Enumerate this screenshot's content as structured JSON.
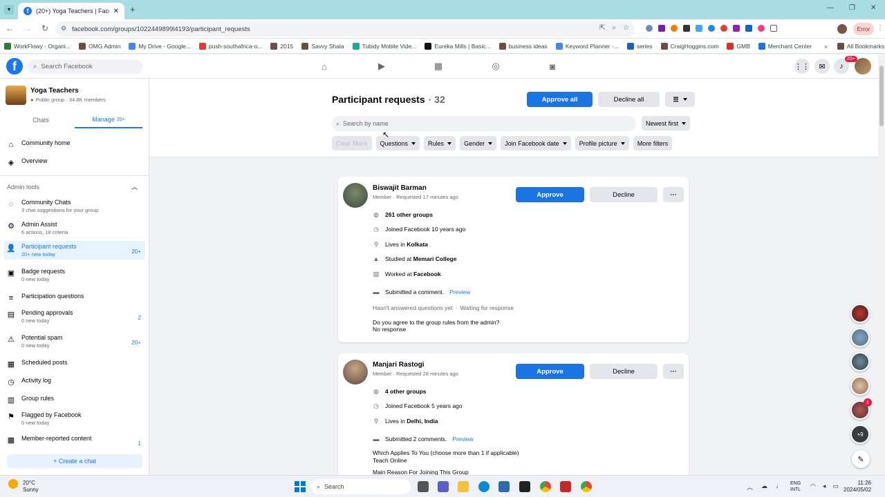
{
  "browser": {
    "tab_title": "(20+) Yoga Teachers | Facebook",
    "url": "facebook.com/groups/1022449899l4193/participant_requests",
    "error_label": "Error",
    "bookmarks": [
      "WorkFlowy - Organi...",
      "OMG Admin",
      "My Drive - Google...",
      "push-southafrica-o...",
      "2015",
      "Savvy Shala",
      "Tubidy Mobile Vide...",
      "Eureka Mills | Basic...",
      "business ideas",
      "Keyword Planner -...",
      "series",
      "CraigHoggins.com",
      "GMB",
      "Merchant Center"
    ],
    "all_bookmarks": "All Bookmarks"
  },
  "header": {
    "search_placeholder": "Search Facebook",
    "notif_badge": "20+"
  },
  "group": {
    "name": "Yoga Teachers",
    "meta": "Public group · 34.8K members",
    "tab_chats": "Chats",
    "tab_manage": "Manage",
    "tab_manage_badge": "20+"
  },
  "sidebar": {
    "community_home": "Community home",
    "overview": "Overview",
    "admin_tools": "Admin tools",
    "items": [
      {
        "title": "Community Chats",
        "sub": "3 chat suggestions for your group",
        "badge": ""
      },
      {
        "title": "Admin Assist",
        "sub": "6 actions, 18 criteria",
        "badge": ""
      },
      {
        "title": "Participant requests",
        "sub": "20+ new today",
        "badge": "20+"
      },
      {
        "title": "Badge requests",
        "sub": "0 new today",
        "badge": ""
      },
      {
        "title": "Participation questions",
        "sub": "",
        "badge": ""
      },
      {
        "title": "Pending approvals",
        "sub": "0 new today",
        "badge": "2"
      },
      {
        "title": "Potential spam",
        "sub": "0 new today",
        "badge": "20+"
      },
      {
        "title": "Scheduled posts",
        "sub": "",
        "badge": ""
      },
      {
        "title": "Activity log",
        "sub": "",
        "badge": ""
      },
      {
        "title": "Group rules",
        "sub": "",
        "badge": ""
      },
      {
        "title": "Flagged by Facebook",
        "sub": "0 new today",
        "badge": ""
      },
      {
        "title": "Member-reported content",
        "sub": "",
        "badge": "1"
      }
    ],
    "create_chat": "+ Create a chat"
  },
  "requests": {
    "title": "Participant requests",
    "count": "· 32",
    "approve_all": "Approve all",
    "decline_all": "Decline all",
    "search_placeholder": "Search by name",
    "sort": "Newest first",
    "filters": {
      "clear": "Clear filters",
      "questions": "Questions",
      "rules": "Rules",
      "gender": "Gender",
      "join_date": "Join Facebook date",
      "profile_picture": "Profile picture",
      "more": "More filters"
    },
    "approve": "Approve",
    "decline": "Decline",
    "more": "···",
    "card1": {
      "name": "Biswajit Barman",
      "meta": "Member · Requested 17 minutes ago",
      "groups": "261 other groups",
      "joined": "Joined Facebook 10 years ago",
      "lives_pre": "Lives in ",
      "lives": "Kolkata",
      "studied_pre": "Studied at ",
      "studied": "Memari College",
      "worked_pre": "Worked at ",
      "worked": "Facebook",
      "comment": "Submitted a comment.",
      "preview": "Preview",
      "questions": "Hasn't answered questions yet",
      "waiting": "Waiting for response",
      "rules_q": "Do you agree to the group rules from the admin?",
      "rules_a": "No response"
    },
    "card2": {
      "name": "Manjari Rastogi",
      "meta": "Member · Requested 28 minutes ago",
      "groups": "4 other groups",
      "joined": "Joined Facebook 5 years ago",
      "lives_pre": "Lives in ",
      "lives": "Delhi, India",
      "comment": "Submitted 2 comments.",
      "preview": "Preview",
      "q1": "Which Applies To You (choose more than 1 if applicable)",
      "a1": "Teach Online",
      "q2": "Main Reason For Joining This Group"
    }
  },
  "taskbar": {
    "temp": "20°C",
    "weather": "Sunny",
    "search": "Search",
    "lang1": "ENG",
    "lang2": "INTL",
    "time": "11:26",
    "date": "2024/05/02"
  },
  "float_badges": {
    "red": "1",
    "plus": "+9"
  },
  "colors": {
    "accent": "#1877f2",
    "approve": "#1b74e4",
    "chrome_tab": "#a8dde3"
  }
}
